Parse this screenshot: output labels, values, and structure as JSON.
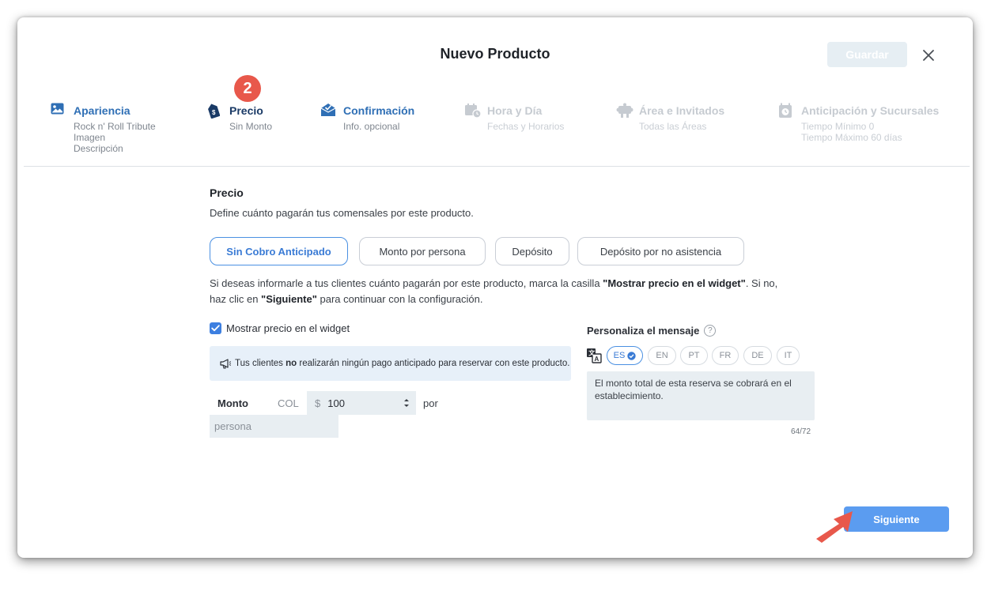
{
  "modal": {
    "title": "Nuevo Producto",
    "save_label": "Guardar"
  },
  "steps": [
    {
      "label": "Apariencia",
      "sub": [
        "Rock n' Roll Tribute",
        "Imagen",
        "Descripción"
      ],
      "state": "completed",
      "icon": "image-icon"
    },
    {
      "label": "Precio",
      "sub": [
        "Sin Monto"
      ],
      "state": "active",
      "badge": "2",
      "icon": "price-tag-icon"
    },
    {
      "label": "Confirmación",
      "sub": [
        "Info. opcional"
      ],
      "state": "completed",
      "icon": "envelope-check-icon"
    },
    {
      "label": "Hora y Día",
      "sub": [
        "Fechas y Horarios"
      ],
      "state": "disabled",
      "icon": "calendar-clock-icon"
    },
    {
      "label": "Área e Invitados",
      "sub": [
        "Todas las Áreas"
      ],
      "state": "disabled",
      "icon": "area-guests-icon"
    },
    {
      "label": "Anticipación y Sucursales",
      "sub": [
        "Tiempo Mínimo 0",
        "Tiempo Máximo 60 días"
      ],
      "state": "disabled",
      "icon": "timer-icon"
    }
  ],
  "price": {
    "title": "Precio",
    "description": "Define cuánto pagarán tus comensales por este producto.",
    "options": [
      "Sin Cobro Anticipado",
      "Monto por persona",
      "Depósito",
      "Depósito por no asistencia"
    ],
    "selected_option": "Sin Cobro Anticipado",
    "info_part1": "Si deseas informarle a tus clientes cuánto pagarán por este producto, marca la casilla ",
    "info_bold1": "\"Mostrar precio en el widget\"",
    "info_part2": ". Si no, haz clic en ",
    "info_bold2": "\"Siguiente\"",
    "info_part3": " para continuar con la configuración.",
    "show_price_label": "Mostrar precio en el widget",
    "show_price_checked": true,
    "notice_part1": "Tus clientes ",
    "notice_bold": "no",
    "notice_part2": " realizarán ningún pago anticipado para reservar con este producto.",
    "amount_label": "Monto",
    "currency": "COL",
    "currency_symbol": "$",
    "amount_value": "100",
    "per_label": "por",
    "per_unit": "persona"
  },
  "message": {
    "title": "Personaliza el mensaje",
    "help": "?",
    "languages": [
      "ES",
      "EN",
      "PT",
      "FR",
      "DE",
      "IT"
    ],
    "selected_language": "ES",
    "text": "El monto total de esta reserva se cobrará en el establecimiento.",
    "counter": "64/72"
  },
  "footer": {
    "next_label": "Siguiente"
  },
  "colors": {
    "accent": "#3a7bd5",
    "primary_button": "#5b9cf0",
    "badge": "#e8584b",
    "arrow": "#e8584b"
  }
}
